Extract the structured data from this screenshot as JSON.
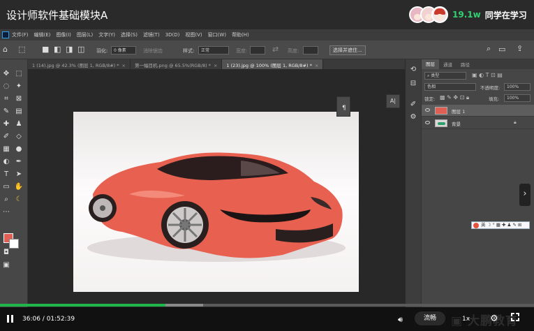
{
  "header": {
    "title": "设计师软件基础模块A",
    "viewer_count": "19.1w",
    "viewer_label": "同学在学习"
  },
  "menu": [
    "文件(F)",
    "编辑(E)",
    "图像(I)",
    "图层(L)",
    "文字(Y)",
    "选择(S)",
    "滤镜(T)",
    "3D(D)",
    "视图(V)",
    "窗口(W)",
    "帮助(H)"
  ],
  "options": {
    "feather_label": "羽化:",
    "feather_value": "0 像素",
    "antialias_label": "消除锯齿",
    "style_label": "样式:",
    "style_value": "正常",
    "width_label": "宽度:",
    "height_label": "高度:",
    "select_mask": "选择并遮住..."
  },
  "doc_tabs": [
    {
      "label": "1 (14).jpg @ 42.3% (图层 1, RGB/8#) *"
    },
    {
      "label": "第一幅目机.png @ 65.5%(RGB/8) *"
    },
    {
      "label": "1 (23).jpg @ 100% (图层 1, RGB/8#) *"
    }
  ],
  "layers_panel": {
    "tabs": [
      "图层",
      "通道",
      "路径"
    ],
    "kind_filter": "类型",
    "blend_mode": "色相",
    "opacity_label": "不透明度:",
    "opacity_value": "100%",
    "lock_label": "锁定:",
    "fill_label": "填充:",
    "fill_value": "100%",
    "layers": [
      {
        "name": "图层 1",
        "selected": true
      },
      {
        "name": "背景",
        "selected": false
      }
    ]
  },
  "ime": {
    "label": "英"
  },
  "player": {
    "time": "36:06 / 01:52:39",
    "progress_fraction": 0.31,
    "buffer_fraction": 0.38,
    "quality": "流畅",
    "speed": "1x"
  },
  "colors": {
    "foreground": "#e05f55",
    "background": "#ffffff",
    "accent_green": "#1fb54a",
    "car_body": "#e8604f"
  }
}
